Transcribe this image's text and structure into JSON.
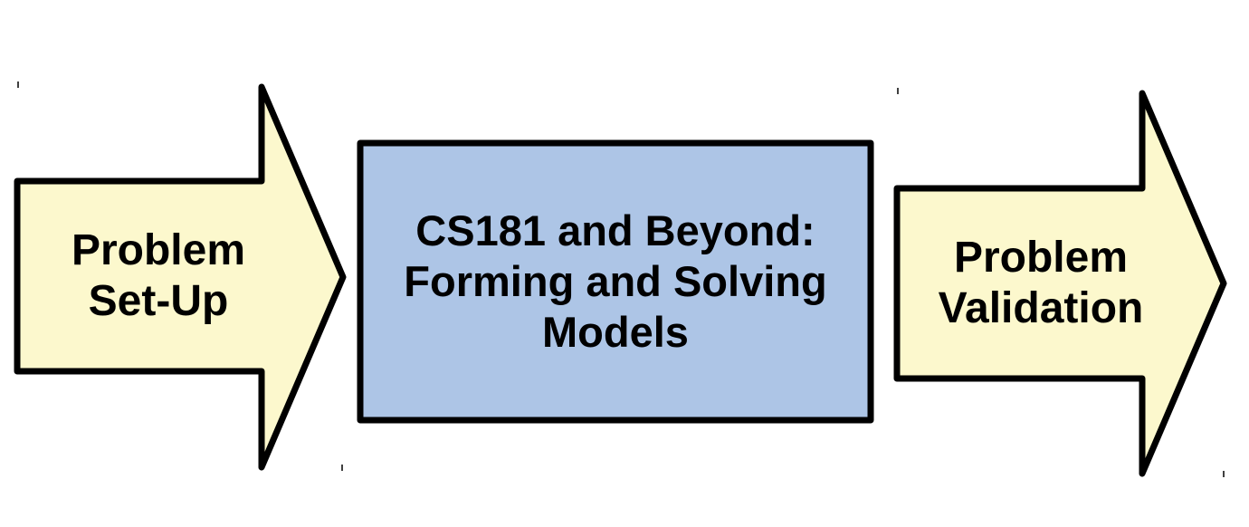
{
  "colors": {
    "arrow_fill": "#fcf8cd",
    "box_fill": "#adc5e6",
    "stroke": "#000000"
  },
  "left_arrow": {
    "line1": "Problem",
    "line2": "Set-Up"
  },
  "center_box": {
    "line1": "CS181 and Beyond:",
    "line2": "Forming and Solving",
    "line3": "Models"
  },
  "right_arrow": {
    "line1": "Problem",
    "line2": "Validation"
  }
}
